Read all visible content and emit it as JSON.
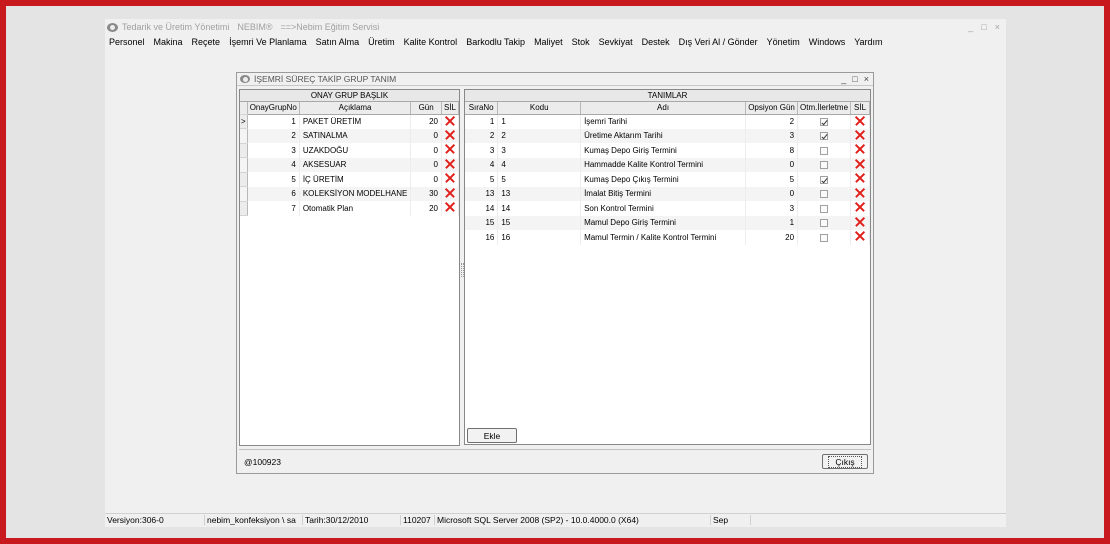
{
  "window": {
    "title_segments": [
      "Tedarik ve Üretim Yönetimi",
      "NEBIM®",
      "==>Nebim Eğitim Servisi"
    ],
    "controls": [
      "_",
      "□",
      "×"
    ]
  },
  "menu": [
    "Personel",
    "Makina",
    "Reçete",
    "İşemri Ve Planlama",
    "Satın Alma",
    "Üretim",
    "Kalite Kontrol",
    "Barkodlu Takip",
    "Maliyet",
    "Stok",
    "Sevkiyat",
    "Destek",
    "Dış Veri Al / Gönder",
    "Yönetim",
    "Windows",
    "Yardım"
  ],
  "dialog": {
    "title": "İŞEMRİ SÜREÇ TAKİP GRUP TANIM",
    "controls": [
      "_",
      "□",
      "×"
    ],
    "left": {
      "header": "ONAY GRUP BAŞLIK",
      "columns": [
        "OnayGrupNo",
        "Açıklama",
        "Gün",
        "SİL"
      ],
      "current_row_marker": ">",
      "rows": [
        {
          "no": "1",
          "aciklama": "PAKET ÜRETİM",
          "gun": "20"
        },
        {
          "no": "2",
          "aciklama": "SATINALMA",
          "gun": "0"
        },
        {
          "no": "3",
          "aciklama": "UZAKDOĞU",
          "gun": "0"
        },
        {
          "no": "4",
          "aciklama": "AKSESUAR",
          "gun": "0"
        },
        {
          "no": "5",
          "aciklama": "İÇ ÜRETİM",
          "gun": "0"
        },
        {
          "no": "6",
          "aciklama": "KOLEKSİYON MODELHANE",
          "gun": "30"
        },
        {
          "no": "7",
          "aciklama": "Otomatik Plan",
          "gun": "20"
        }
      ]
    },
    "right": {
      "header": "TANIMLAR",
      "columns": [
        "SıraNo",
        "Kodu",
        "Adı",
        "Opsiyon Gün",
        "Otm.İlerletme",
        "SİL"
      ],
      "rows": [
        {
          "sira": "1",
          "kodu": "1",
          "adi": "İşemri Tarihi",
          "gun": "2",
          "otm": true
        },
        {
          "sira": "2",
          "kodu": "2",
          "adi": "Üretime Aktarım Tarihi",
          "gun": "3",
          "otm": true
        },
        {
          "sira": "3",
          "kodu": "3",
          "adi": "Kumaş Depo Giriş Termini",
          "gun": "8",
          "otm": false
        },
        {
          "sira": "4",
          "kodu": "4",
          "adi": "Hammadde Kalite Kontrol Termini",
          "gun": "0",
          "otm": false
        },
        {
          "sira": "5",
          "kodu": "5",
          "adi": "Kumaş Depo Çıkış Termini",
          "gun": "5",
          "otm": true
        },
        {
          "sira": "13",
          "kodu": "13",
          "adi": "İmalat Bitiş Termini",
          "gun": "0",
          "otm": false
        },
        {
          "sira": "14",
          "kodu": "14",
          "adi": "Son Kontrol Termini",
          "gun": "3",
          "otm": false
        },
        {
          "sira": "15",
          "kodu": "15",
          "adi": "Mamul Depo Giriş Termini",
          "gun": "1",
          "otm": false
        },
        {
          "sira": "16",
          "kodu": "16",
          "adi": "Mamul Termin / Kalite Kontrol Termini",
          "gun": "20",
          "otm": false
        }
      ]
    },
    "add_button": "Ekle",
    "exit_button": "Çıkış",
    "code_label": "@100923"
  },
  "status": [
    "Versiyon:306-0",
    "nebim_konfeksiyon \\ sa",
    "Tarih:30/12/2010",
    "110207",
    "Microsoft SQL Server 2008 (SP2) - 10.0.4000.0 (X64)",
    "Sep"
  ],
  "colors": {
    "frame": "#c8191e",
    "delete": "#e0201a"
  }
}
